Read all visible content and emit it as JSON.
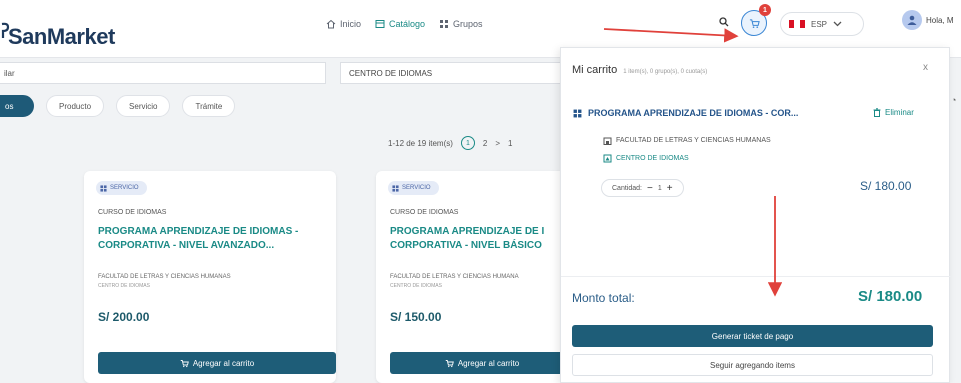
{
  "header": {
    "logo_text": "SanMarket",
    "nav": [
      {
        "label": "Inicio",
        "icon": "home-icon"
      },
      {
        "label": "Catálogo",
        "icon": "catalog-icon"
      },
      {
        "label": "Grupos",
        "icon": "groups-icon"
      }
    ],
    "cart_count": "1",
    "language": "ESP",
    "user_greeting": "Hola, M"
  },
  "filters": {
    "search_value": "ilar",
    "center_select": "CENTRO DE IDIOMAS",
    "chips": [
      "os",
      "Producto",
      "Servicio",
      "Trámite"
    ]
  },
  "pager": {
    "range_text": "1-12 de 19 item(s)",
    "page_current": "1",
    "page_next": "2",
    "page_more": "1"
  },
  "products": [
    {
      "badge": "SERVICIO",
      "category": "CURSO DE IDIOMAS",
      "title": "PROGRAMA APRENDIZAJE DE IDIOMAS - CORPORATIVA - NIVEL AVANZADO...",
      "faculty": "FACULTAD DE LETRAS Y CIENCIAS HUMANAS",
      "center": "CENTRO DE IDIOMAS",
      "price": "S/ 200.00",
      "button": "Agregar al carrito"
    },
    {
      "badge": "SERVICIO",
      "category": "CURSO DE IDIOMAS",
      "title": "PROGRAMA APRENDIZAJE DE I CORPORATIVA - NIVEL BÁSICO",
      "faculty": "FACULTAD DE LETRAS Y CIENCIAS HUMANA",
      "center": "CENTRO DE IDIOMAS",
      "price": "S/ 150.00",
      "button": "Agregar al carrito"
    }
  ],
  "cart": {
    "title": "Mi carrito",
    "subtitle": "1 item(s), 0 grupo(s), 0 cuota(s)",
    "close": "x",
    "item": {
      "title": "PROGRAMA APRENDIZAJE DE IDIOMAS - COR...",
      "remove": "Eliminar",
      "faculty": "FACULTAD DE LETRAS Y CIENCIAS HUMANAS",
      "center": "CENTRO DE IDIOMAS",
      "qty_label": "Cantidad:",
      "qty_minus": "−",
      "qty_value": "1",
      "qty_plus": "+",
      "price": "S/ 180.00"
    },
    "total_label": "Monto total:",
    "total_value": "S/ 180.00",
    "pay_button": "Generar ticket de pago",
    "continue_button": "Seguir agregando items"
  },
  "colors": {
    "teal": "#1a8a86",
    "navy_button": "#1e5d78",
    "annotation_red": "#e0413b"
  }
}
